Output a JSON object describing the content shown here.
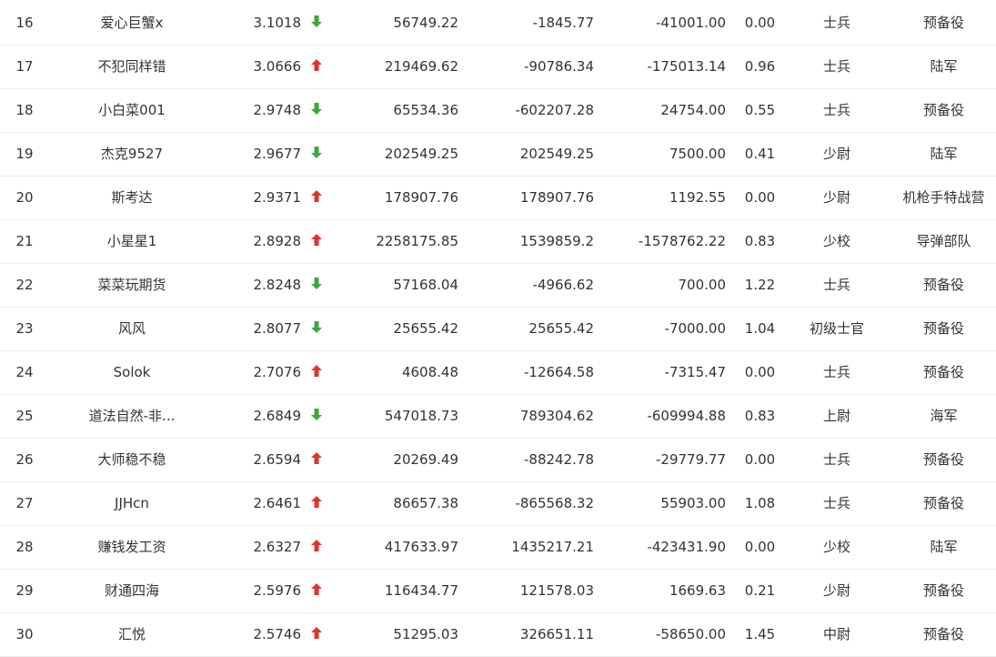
{
  "colors": {
    "up": "#e0332f",
    "down": "#3aab3a",
    "text": "#333333",
    "divider": "#ececec"
  },
  "rows": [
    {
      "rank": "16",
      "name": "爱心巨蟹x",
      "score": "3.1018",
      "trend": "down",
      "v1": "56749.22",
      "v2": "-1845.77",
      "v3": "-41001.00",
      "v4": "0.00",
      "level": "士兵",
      "branch": "预备役"
    },
    {
      "rank": "17",
      "name": "不犯同样错",
      "score": "3.0666",
      "trend": "up",
      "v1": "219469.62",
      "v2": "-90786.34",
      "v3": "-175013.14",
      "v4": "0.96",
      "level": "士兵",
      "branch": "陆军"
    },
    {
      "rank": "18",
      "name": "小白菜001",
      "score": "2.9748",
      "trend": "down",
      "v1": "65534.36",
      "v2": "-602207.28",
      "v3": "24754.00",
      "v4": "0.55",
      "level": "士兵",
      "branch": "预备役"
    },
    {
      "rank": "19",
      "name": "杰克9527",
      "score": "2.9677",
      "trend": "down",
      "v1": "202549.25",
      "v2": "202549.25",
      "v3": "7500.00",
      "v4": "0.41",
      "level": "少尉",
      "branch": "陆军"
    },
    {
      "rank": "20",
      "name": "斯考达",
      "score": "2.9371",
      "trend": "up",
      "v1": "178907.76",
      "v2": "178907.76",
      "v3": "1192.55",
      "v4": "0.00",
      "level": "少尉",
      "branch": "机枪手特战营"
    },
    {
      "rank": "21",
      "name": "小星星1",
      "score": "2.8928",
      "trend": "up",
      "v1": "2258175.85",
      "v2": "1539859.2",
      "v3": "-1578762.22",
      "v4": "0.83",
      "level": "少校",
      "branch": "导弹部队"
    },
    {
      "rank": "22",
      "name": "菜菜玩期货",
      "score": "2.8248",
      "trend": "down",
      "v1": "57168.04",
      "v2": "-4966.62",
      "v3": "700.00",
      "v4": "1.22",
      "level": "士兵",
      "branch": "预备役"
    },
    {
      "rank": "23",
      "name": "风风",
      "score": "2.8077",
      "trend": "down",
      "v1": "25655.42",
      "v2": "25655.42",
      "v3": "-7000.00",
      "v4": "1.04",
      "level": "初级士官",
      "branch": "预备役"
    },
    {
      "rank": "24",
      "name": "Solok",
      "score": "2.7076",
      "trend": "up",
      "v1": "4608.48",
      "v2": "-12664.58",
      "v3": "-7315.47",
      "v4": "0.00",
      "level": "士兵",
      "branch": "预备役"
    },
    {
      "rank": "25",
      "name": "道法自然-非...",
      "score": "2.6849",
      "trend": "down",
      "v1": "547018.73",
      "v2": "789304.62",
      "v3": "-609994.88",
      "v4": "0.83",
      "level": "上尉",
      "branch": "海军"
    },
    {
      "rank": "26",
      "name": "大师稳不稳",
      "score": "2.6594",
      "trend": "up",
      "v1": "20269.49",
      "v2": "-88242.78",
      "v3": "-29779.77",
      "v4": "0.00",
      "level": "士兵",
      "branch": "预备役"
    },
    {
      "rank": "27",
      "name": "JJHcn",
      "score": "2.6461",
      "trend": "up",
      "v1": "86657.38",
      "v2": "-865568.32",
      "v3": "55903.00",
      "v4": "1.08",
      "level": "士兵",
      "branch": "预备役"
    },
    {
      "rank": "28",
      "name": "赚钱发工资",
      "score": "2.6327",
      "trend": "up",
      "v1": "417633.97",
      "v2": "1435217.21",
      "v3": "-423431.90",
      "v4": "0.00",
      "level": "少校",
      "branch": "陆军"
    },
    {
      "rank": "29",
      "name": "财通四海",
      "score": "2.5976",
      "trend": "up",
      "v1": "116434.77",
      "v2": "121578.03",
      "v3": "1669.63",
      "v4": "0.21",
      "level": "少尉",
      "branch": "预备役"
    },
    {
      "rank": "30",
      "name": "汇悦",
      "score": "2.5746",
      "trend": "up",
      "v1": "51295.03",
      "v2": "326651.11",
      "v3": "-58650.00",
      "v4": "1.45",
      "level": "中尉",
      "branch": "预备役"
    }
  ]
}
